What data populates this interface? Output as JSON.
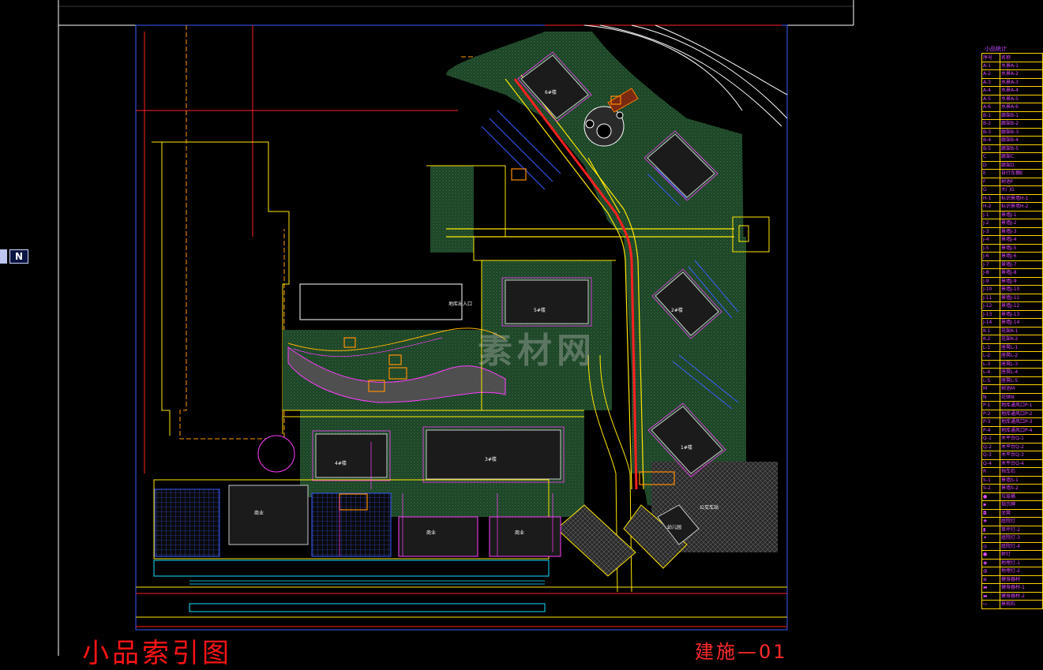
{
  "title": "小品索引图",
  "sheet_number": "建施—01",
  "north_label": "N",
  "watermark": "素材网",
  "building_labels": {
    "clubhouse": "地库出入口",
    "commercial_a": "商业",
    "commercial_b": "商业",
    "commercial_c": "商业",
    "bldg_5": "5#楼",
    "bldg_4": "4#楼",
    "bldg_3": "3#楼",
    "bldg_2": "2#楼",
    "bldg_1": "1#楼",
    "bldg_6": "6#楼",
    "kindergarten": "幼儿园",
    "station": "公交车站"
  },
  "legend": {
    "title": "小品统计",
    "header": [
      "序号",
      "名称"
    ],
    "rows": [
      [
        "A-1",
        "水景A-1"
      ],
      [
        "A-2",
        "水景A-2"
      ],
      [
        "A-3",
        "水景A-3"
      ],
      [
        "A-4",
        "水景A-4"
      ],
      [
        "A-5",
        "水景A-5"
      ],
      [
        "A-6",
        "水景A-6"
      ],
      [
        "B-1",
        "廊架B-1"
      ],
      [
        "B-2",
        "廊架B-2"
      ],
      [
        "B-3",
        "廊架B-3"
      ],
      [
        "B-4",
        "廊架B-4"
      ],
      [
        "B-5",
        "廊架B-5"
      ],
      [
        "C",
        "廊架C"
      ],
      [
        "D",
        "廊架D"
      ],
      [
        "E",
        "自行车棚E"
      ],
      [
        "F",
        "树池F"
      ],
      [
        "G",
        "大门G"
      ],
      [
        "H-1",
        "标识景墙H-1"
      ],
      [
        "H-2",
        "标识景墙H-2"
      ],
      [
        "J-1",
        "景墙J-1"
      ],
      [
        "J-2",
        "景墙J-2"
      ],
      [
        "J-3",
        "景墙J-3"
      ],
      [
        "J-4",
        "景墙J-4"
      ],
      [
        "J-5",
        "景墙J-5"
      ],
      [
        "J-6",
        "景墙J-6"
      ],
      [
        "J-7",
        "景墙J-7"
      ],
      [
        "J-8",
        "景墙J-8"
      ],
      [
        "J-9",
        "景墙J-9"
      ],
      [
        "J-10",
        "景墙J-10"
      ],
      [
        "J-11",
        "景墙J-11"
      ],
      [
        "J-12",
        "景墙J-12"
      ],
      [
        "J-13",
        "景墙J-13"
      ],
      [
        "J-14",
        "景墙J-14"
      ],
      [
        "K-1",
        "花架K-1"
      ],
      [
        "K-2",
        "花架K-2"
      ],
      [
        "L-1",
        "座凳L-1"
      ],
      [
        "L-2",
        "座凳L-2"
      ],
      [
        "L-3",
        "座凳L-3"
      ],
      [
        "L-4",
        "座凳L-4"
      ],
      [
        "L-5",
        "座凳L-5"
      ],
      [
        "M",
        "树池M"
      ],
      [
        "N",
        "花钵N"
      ],
      [
        "P-1",
        "地库通风口P-1"
      ],
      [
        "P-2",
        "地库通风口P-2"
      ],
      [
        "P-3",
        "地库通风口P-3"
      ],
      [
        "P-4",
        "地库通风口P-4"
      ],
      [
        "Q-1",
        "木平台Q-1"
      ],
      [
        "Q-2",
        "木平台Q-2"
      ],
      [
        "Q-3",
        "木平台Q-3"
      ],
      [
        "Q-4",
        "木平台Q-4"
      ],
      [
        "R",
        "挡车石"
      ],
      [
        "S-1",
        "景墙S-1"
      ],
      [
        "S-2",
        "景墙S-2"
      ],
      [
        "●",
        "垃圾桶"
      ],
      [
        "▪",
        "指示牌"
      ],
      [
        "◘",
        "坐凳"
      ],
      [
        "✚",
        "庭院灯"
      ],
      [
        "▮",
        "草坪灯-2"
      ],
      [
        "✦",
        "庭院灯-3"
      ],
      [
        "◎",
        "庭院灯-4"
      ],
      [
        "●",
        "射灯"
      ],
      [
        "◉",
        "地埋灯-1"
      ],
      [
        "◍",
        "地埋灯-2"
      ],
      [
        "⊕",
        "健身器材"
      ],
      [
        "▬",
        "健身器材-1"
      ],
      [
        "▬",
        "健身器材-2"
      ],
      [
        "▭",
        "景观石"
      ]
    ]
  },
  "colors": {
    "background": "#000000",
    "lawn": "#1f4a2a",
    "road_outline": "#ffe600",
    "redline": "#ff2020",
    "building": "#c9c9c9",
    "magenta": "#ff3cff",
    "cyan": "#19e0ff",
    "blue": "#3a5dff"
  }
}
